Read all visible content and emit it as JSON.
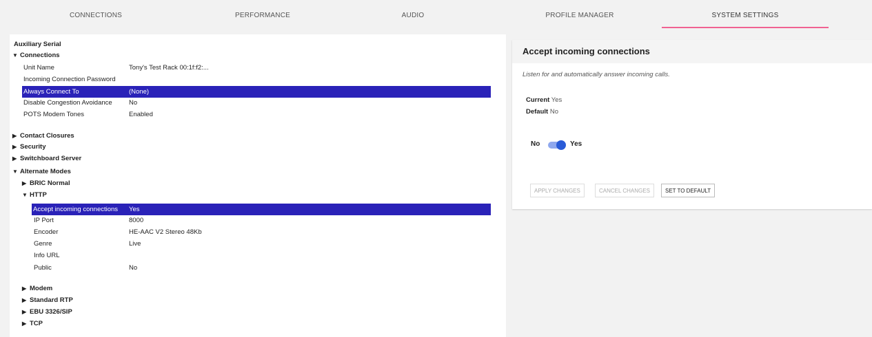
{
  "tabs": [
    {
      "label": "CONNECTIONS",
      "active": false
    },
    {
      "label": "PERFORMANCE",
      "active": false
    },
    {
      "label": "AUDIO",
      "active": false
    },
    {
      "label": "PROFILE MANAGER",
      "active": false
    },
    {
      "label": "SYSTEM SETTINGS",
      "active": true
    }
  ],
  "accent_color": "#f06292",
  "selection_color": "#2a22b8",
  "tree": {
    "title": "Auxiliary Serial",
    "connections": {
      "label": "Connections",
      "items": [
        {
          "label": "Unit Name",
          "value": "Tony's Test Rack 00:1f:f2:..."
        },
        {
          "label": "Incoming Connection Password",
          "value": ""
        },
        {
          "label": "Always Connect To",
          "value": "(None)"
        },
        {
          "label": "Disable Congestion Avoidance",
          "value": "No"
        },
        {
          "label": "POTS Modem Tones",
          "value": "Enabled"
        }
      ]
    },
    "contact_closures": "Contact Closures",
    "security": "Security",
    "switchboard_server": "Switchboard Server",
    "alternate_modes": {
      "label": "Alternate Modes",
      "bric_normal": "BRIC Normal",
      "http": {
        "label": "HTTP",
        "items": [
          {
            "label": "Accept incoming connections",
            "value": "Yes"
          },
          {
            "label": "IP Port",
            "value": "8000"
          },
          {
            "label": "Encoder",
            "value": "HE-AAC V2 Stereo 48Kb"
          },
          {
            "label": "Genre",
            "value": "Live"
          },
          {
            "label": "Info URL",
            "value": ""
          },
          {
            "label": "Public",
            "value": "No"
          }
        ]
      },
      "modem": "Modem",
      "standard_rtp": "Standard RTP",
      "ebu": "EBU 3326/SIP",
      "tcp": "TCP"
    }
  },
  "detail": {
    "title": "Accept incoming connections",
    "description": "Listen for and automatically answer incoming calls.",
    "current_label": "Current",
    "current_value": "Yes",
    "default_label": "Default",
    "default_value": "No",
    "toggle_off_label": "No",
    "toggle_on_label": "Yes",
    "toggle_on": true,
    "buttons": {
      "apply": "APPLY CHANGES",
      "cancel": "CANCEL CHANGES",
      "set_default": "SET TO DEFAULT"
    }
  }
}
